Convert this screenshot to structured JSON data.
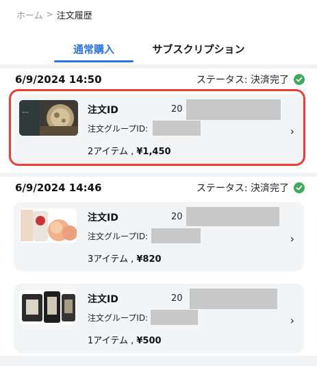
{
  "breadcrumb": {
    "home": "ホーム",
    "separator": ">",
    "current": "注文履歴"
  },
  "tabs": [
    {
      "label": "通常購入",
      "active": true
    },
    {
      "label": "サブスクリプション",
      "active": false
    }
  ],
  "colors": {
    "accent": "#2a73e6",
    "status_success": "#3dab5a",
    "highlight": "#ee3b35",
    "card_bg": "#f3f4f6"
  },
  "status_icon": "check-circle-icon",
  "groups": [
    {
      "datetime": "6/9/2024 14:50",
      "status_text": "ステータス:  決済完了",
      "orders": [
        {
          "id_label": "注文ID",
          "id_prefix": "20",
          "group_label": "注文グループID:",
          "item_count": "2アイテム ,",
          "amount": "¥1,450",
          "highlighted": true
        }
      ]
    },
    {
      "datetime": "6/9/2024 14:46",
      "status_text": "ステータス:  決済完了",
      "orders": [
        {
          "id_label": "注文ID",
          "id_prefix": "20",
          "group_label": "注文グループID:",
          "item_count": "3アイテム ,",
          "amount": "¥820",
          "highlighted": false
        },
        {
          "id_label": "注文ID",
          "id_prefix": "20",
          "group_label": "注文グループID:",
          "item_count": "1アイテム ,",
          "amount": "¥500",
          "highlighted": false
        }
      ]
    }
  ]
}
